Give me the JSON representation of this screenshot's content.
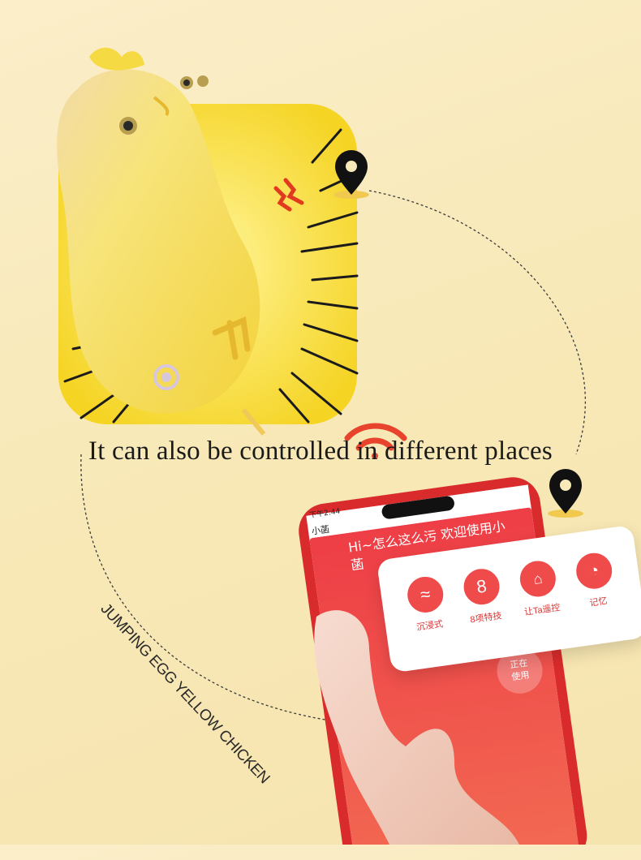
{
  "headline": "It can also be controlled in different places",
  "side_caption": "JUMPING EGG YELLOW CHICKEN",
  "phone": {
    "status_time": "下午2:44",
    "app_name": "小菡",
    "greeting": "Hi~怎么这么污 欢迎使用小菡",
    "in_use": [
      "正在",
      "使用"
    ]
  },
  "modes": [
    {
      "label": "沉浸式",
      "icon": "waves-icon"
    },
    {
      "label": "8项特技",
      "icon": "eight-icon"
    },
    {
      "label": "让Ta遥控",
      "icon": "remote-icon"
    },
    {
      "label": "记忆",
      "icon": "clock-icon"
    }
  ],
  "colors": {
    "background": "#f8e9b8",
    "product_yellow": "#f7d93c",
    "app_red": "#ec3b44",
    "phone_body": "#d92b2b"
  }
}
